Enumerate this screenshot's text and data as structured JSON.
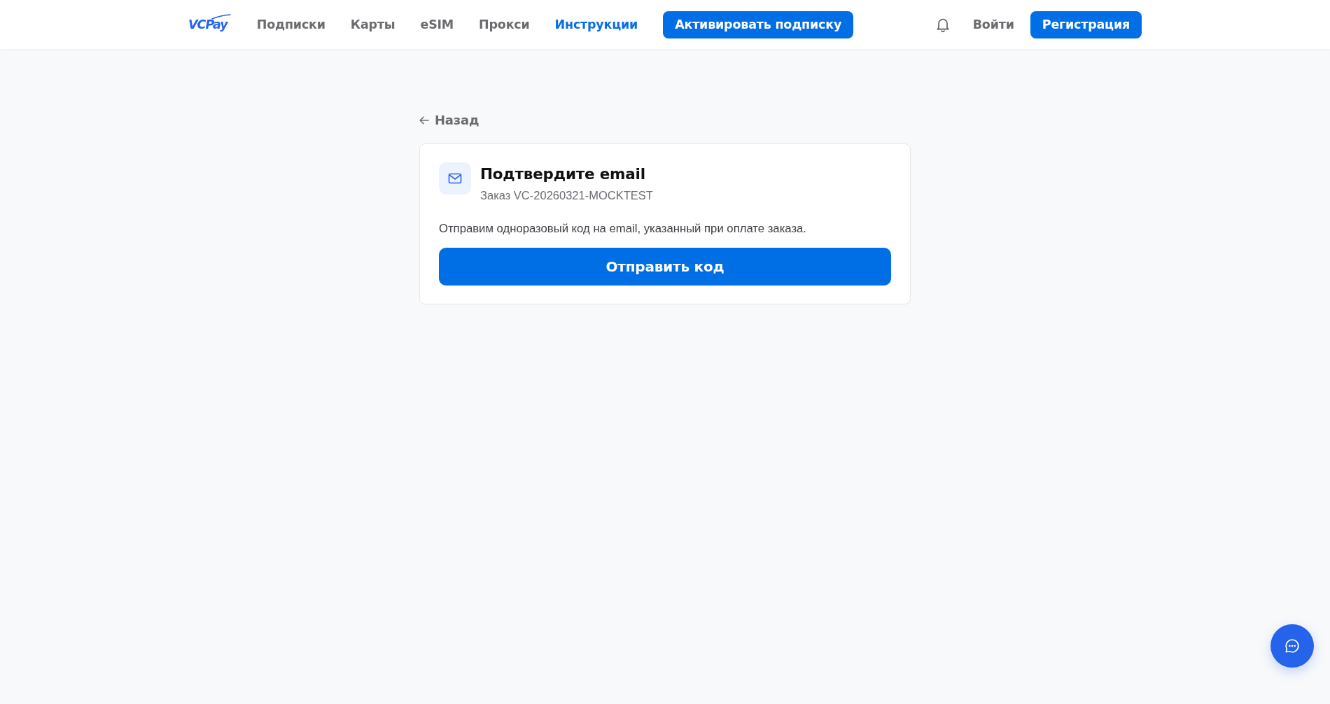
{
  "navbar": {
    "logo": "VCPay",
    "links": [
      {
        "label": "Подписки",
        "selected": false
      },
      {
        "label": "Карты",
        "selected": false
      },
      {
        "label": "eSIM",
        "selected": false
      },
      {
        "label": "Прокси",
        "selected": false
      },
      {
        "label": "Инструкции",
        "selected": true
      }
    ],
    "cta_button": "Активировать подписку",
    "login": "Войти",
    "register_button": "Регистрация"
  },
  "back_link": "Назад",
  "card": {
    "title": "Подтвердите email",
    "subtitle": "Заказ VC-20260321-MOCKTEST",
    "description": "Отправим одноразовый код на email, указанный при оплате заказа.",
    "button": "Отправить код"
  }
}
